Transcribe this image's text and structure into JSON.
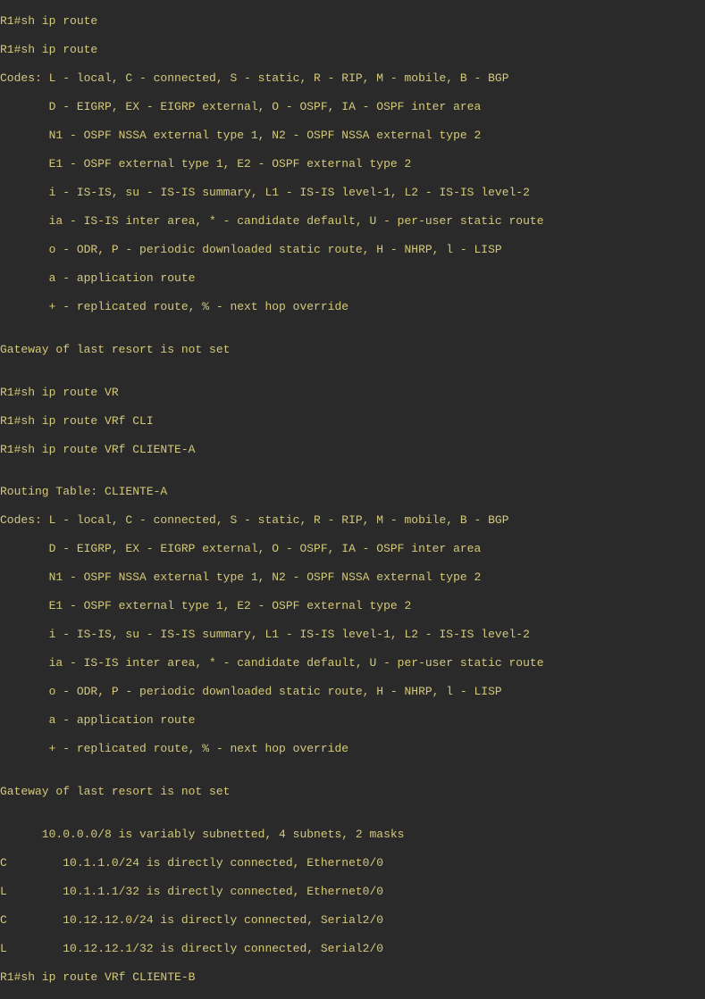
{
  "terminal": {
    "lines": [
      "R1#sh ip route",
      "R1#sh ip route",
      "Codes: L - local, C - connected, S - static, R - RIP, M - mobile, B - BGP",
      "       D - EIGRP, EX - EIGRP external, O - OSPF, IA - OSPF inter area",
      "       N1 - OSPF NSSA external type 1, N2 - OSPF NSSA external type 2",
      "       E1 - OSPF external type 1, E2 - OSPF external type 2",
      "       i - IS-IS, su - IS-IS summary, L1 - IS-IS level-1, L2 - IS-IS level-2",
      "       ia - IS-IS inter area, * - candidate default, U - per-user static route",
      "       o - ODR, P - periodic downloaded static route, H - NHRP, l - LISP",
      "       a - application route",
      "       + - replicated route, % - next hop override",
      "",
      "Gateway of last resort is not set",
      "",
      "R1#sh ip route VR",
      "R1#sh ip route VRf CLI",
      "R1#sh ip route VRf CLIENTE-A",
      "",
      "Routing Table: CLIENTE-A",
      "Codes: L - local, C - connected, S - static, R - RIP, M - mobile, B - BGP",
      "       D - EIGRP, EX - EIGRP external, O - OSPF, IA - OSPF inter area",
      "       N1 - OSPF NSSA external type 1, N2 - OSPF NSSA external type 2",
      "       E1 - OSPF external type 1, E2 - OSPF external type 2",
      "       i - IS-IS, su - IS-IS summary, L1 - IS-IS level-1, L2 - IS-IS level-2",
      "       ia - IS-IS inter area, * - candidate default, U - per-user static route",
      "       o - ODR, P - periodic downloaded static route, H - NHRP, l - LISP",
      "       a - application route",
      "       + - replicated route, % - next hop override",
      "",
      "Gateway of last resort is not set",
      "",
      "      10.0.0.0/8 is variably subnetted, 4 subnets, 2 masks",
      "C        10.1.1.0/24 is directly connected, Ethernet0/0",
      "L        10.1.1.1/32 is directly connected, Ethernet0/0",
      "C        10.12.12.0/24 is directly connected, Serial2/0",
      "L        10.12.12.1/32 is directly connected, Serial2/0",
      "R1#sh ip route VRf CLIENTE-B"
    ]
  }
}
